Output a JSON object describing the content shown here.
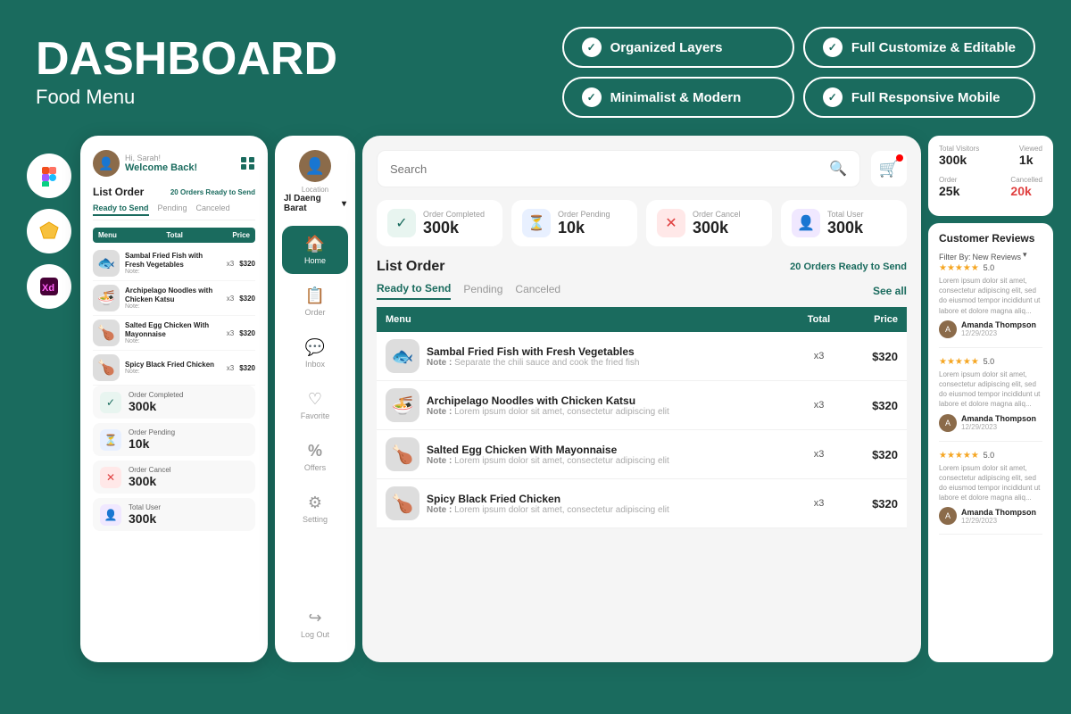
{
  "header": {
    "title": "DASHBOARD",
    "subtitle": "Food Menu",
    "badges": [
      {
        "id": "badge1",
        "label": "Organized Layers"
      },
      {
        "id": "badge2",
        "label": "Full Customize & Editable"
      },
      {
        "id": "badge3",
        "label": "Minimalist & Modern"
      },
      {
        "id": "badge4",
        "label": "Full Responsive Mobile"
      }
    ]
  },
  "mobile": {
    "greeting": "Hi, Sarah!",
    "welcome": "Welcome Back!",
    "list_order_title": "List Order",
    "ready_badge": "20 Orders Ready to Send",
    "tabs": [
      "Ready to Send",
      "Pending",
      "Canceled"
    ],
    "table_headers": [
      "Menu",
      "Total",
      "Price"
    ],
    "items": [
      {
        "name": "Sambal Fried Fish with Fresh Vegetables",
        "note": "Note:",
        "qty": "x3",
        "price": "$320",
        "emoji": "🐟"
      },
      {
        "name": "Archipelago Noodles with Chicken Katsu",
        "note": "Note:",
        "qty": "x3",
        "price": "$320",
        "emoji": "🍜"
      },
      {
        "name": "Salted Egg Chicken With Mayonnaise",
        "note": "Note:",
        "qty": "x3",
        "price": "$320",
        "emoji": "🍗"
      },
      {
        "name": "Spicy Black Fried Chicken",
        "note": "Note:",
        "qty": "x3",
        "price": "$320",
        "emoji": "🍗"
      }
    ],
    "stats": [
      {
        "label": "Order Completed",
        "value": "300k",
        "iconType": "green",
        "icon": "✓"
      },
      {
        "label": "Order Pending",
        "value": "10k",
        "iconType": "blue",
        "icon": "⏳"
      },
      {
        "label": "Order Cancel",
        "value": "300k",
        "iconType": "red",
        "icon": "✕"
      },
      {
        "label": "Total User",
        "value": "300k",
        "iconType": "purple",
        "icon": "👤"
      }
    ]
  },
  "nav": {
    "location_label": "Location",
    "location": "Jl Daeng Barat",
    "items": [
      {
        "id": "home",
        "label": "Home",
        "icon": "🏠",
        "active": true
      },
      {
        "id": "order",
        "label": "Order",
        "icon": "📋",
        "active": false
      },
      {
        "id": "inbox",
        "label": "Inbox",
        "icon": "💬",
        "active": false
      },
      {
        "id": "favorite",
        "label": "Favorite",
        "icon": "♡",
        "active": false
      },
      {
        "id": "offers",
        "label": "Offers",
        "icon": "%",
        "active": false
      },
      {
        "id": "setting",
        "label": "Setting",
        "icon": "⚙",
        "active": false
      }
    ],
    "logout_label": "Log Out"
  },
  "dashboard": {
    "search_placeholder": "Search",
    "stat_cards": [
      {
        "label": "Order Completed",
        "value": "300k",
        "iconType": "green",
        "icon": "✓"
      },
      {
        "label": "Order Pending",
        "value": "10k",
        "iconType": "blue",
        "icon": "⏳"
      },
      {
        "label": "Order Cancel",
        "value": "300k",
        "iconType": "red",
        "icon": "✕"
      },
      {
        "label": "Total User",
        "value": "300k",
        "iconType": "purple",
        "icon": "👤"
      }
    ],
    "list_order_title": "List Order",
    "ready_badge": "20 Orders Ready to Send",
    "order_tabs": [
      "Ready to Send",
      "Pending",
      "Canceled"
    ],
    "see_all": "See all",
    "table_headers": [
      "Menu",
      "Total",
      "Price"
    ],
    "items": [
      {
        "name": "Sambal Fried Fish with Fresh Vegetables",
        "note": "Separate the chili sauce and cook the fried fish",
        "qty": "x3",
        "price": "$320",
        "emoji": "🐟"
      },
      {
        "name": "Archipelago Noodles with Chicken Katsu",
        "note": "Lorem ipsum dolor sit amet, consectetur adipiscing elit",
        "qty": "x3",
        "price": "$320",
        "emoji": "🍜"
      },
      {
        "name": "Salted Egg Chicken With Mayonnaise",
        "note": "Lorem ipsum dolor sit amet, consectetur adipiscing elit",
        "qty": "x3",
        "price": "$320",
        "emoji": "🍗"
      },
      {
        "name": "Spicy Black Fried Chicken",
        "note": "Lorem ipsum dolor sit amet, consectetur adipiscing elit",
        "qty": "x3",
        "price": "$320",
        "emoji": "🍗"
      }
    ]
  },
  "right_panel": {
    "stats": [
      {
        "label": "Total Visitors",
        "value": "300k"
      },
      {
        "label": "Viewed",
        "value": "1k"
      },
      {
        "label": "Order",
        "value": "25k"
      },
      {
        "label": "Cancelled",
        "value": "20k",
        "isRed": true
      }
    ],
    "reviews": {
      "title": "Customer Reviews",
      "filter_label": "Filter By:",
      "filter_value": "New Reviews",
      "items": [
        {
          "stars": 5,
          "rating": "5.0",
          "text": "Lorem ipsum dolor sit amet, consectetur adipiscing elit, sed do eiusmod tempor incididunt ut labore et dolore magna aliq...",
          "author": "Amanda Thompson",
          "date": "12/29/2023"
        },
        {
          "stars": 5,
          "rating": "5.0",
          "text": "Lorem ipsum dolor sit amet, consectetur adipiscing elit, sed do eiusmod tempor incididunt ut labore et dolore magna aliq...",
          "author": "Amanda Thompson",
          "date": "12/29/2023"
        },
        {
          "stars": 5,
          "rating": "5.0",
          "text": "Lorem ipsum dolor sit amet, consectetur adipiscing elit, sed do eiusmod tempor incididunt ut labore et dolore magna aliq...",
          "author": "Amanda Thompson",
          "date": "12/29/2023"
        }
      ]
    }
  },
  "tools": [
    {
      "name": "Figma",
      "color": "#1a1a2e",
      "symbol": "F"
    },
    {
      "name": "Sketch",
      "color": "#f7c13e",
      "symbol": "S"
    },
    {
      "name": "XD",
      "color": "#ff61f6",
      "symbol": "Xd"
    }
  ]
}
